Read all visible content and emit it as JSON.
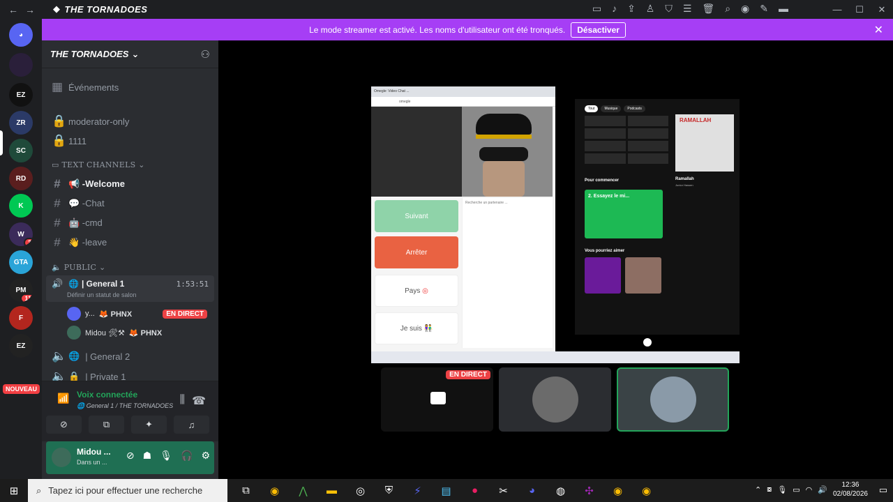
{
  "titlebar": {
    "server_name": "THE TORNADOES",
    "back": "←",
    "forward": "→"
  },
  "rail": {
    "servers": [
      {
        "label": "EZ",
        "color": "#111"
      },
      {
        "label": "ZR",
        "color": "#2b3a67"
      },
      {
        "label": "SC",
        "color": "#1f4a3a"
      },
      {
        "label": "RD",
        "color": "#5a1e1e"
      },
      {
        "label": "K",
        "color": "#00c853"
      },
      {
        "label": "W",
        "color": "#3b2b5a",
        "badge": "3"
      },
      {
        "label": "GTA",
        "color": "#2aa4d8"
      },
      {
        "label": "PM",
        "color": "#222",
        "badge": "11"
      },
      {
        "label": "F",
        "color": "#b3261e"
      },
      {
        "label": "EZ",
        "color": "#222"
      }
    ],
    "new_label": "NOUVEAU"
  },
  "banner": {
    "text": "Le mode streamer est activé. Les noms d'utilisateur ont été tronqués.",
    "button": "Désactiver"
  },
  "sidebar": {
    "guild_name": "THE TORNADOES",
    "events": "Événements",
    "locked_channels": [
      "moderator-only",
      "1111"
    ],
    "text_category": "TEXT CHANNELS",
    "text_channels": [
      "📢 -Welcome",
      "💬 -Chat",
      "🤖 -cmd",
      "👋 -leave"
    ],
    "public_category": "PUBLIC",
    "voice_active": {
      "name": "| General 1",
      "time": "1:53:51",
      "status": "Définir un statut de salon"
    },
    "voice_users": [
      {
        "name": "y...",
        "tag": "PHNX",
        "live": "EN DIRECT"
      },
      {
        "name": "Midou 🛠⚒",
        "tag": "PHNX"
      }
    ],
    "voice_channels": [
      "| General 2",
      "| Private 1"
    ]
  },
  "voice_panel": {
    "title": "Voix connectée",
    "location": "General 1 / THE TORNADOES"
  },
  "user_panel": {
    "name": "Midou ...",
    "status": "Dans un ..."
  },
  "stream": {
    "tab_title": "Omegle: Video Chat ...",
    "url": "omegle",
    "buttons": {
      "next": "Suivant",
      "stop": "Arrêter",
      "country": "Pays",
      "iam": "Je suis"
    },
    "chat_placeholder": "Recherche un partenaire ...",
    "spotify": {
      "tabs": [
        "Tout",
        "Musique",
        "Podcasts"
      ],
      "start": "Pour commencer",
      "try_title": "2. Essayez le mi...",
      "might_like": "Vous pourriez aimer",
      "song": "Ramallah",
      "artist": "Junior Hassen"
    }
  },
  "tiles": {
    "live": "EN DIRECT"
  },
  "taskbar": {
    "search_placeholder": "Tapez ici pour effectuer une recherche",
    "time": "12:36",
    "date": "02/08/2026"
  }
}
